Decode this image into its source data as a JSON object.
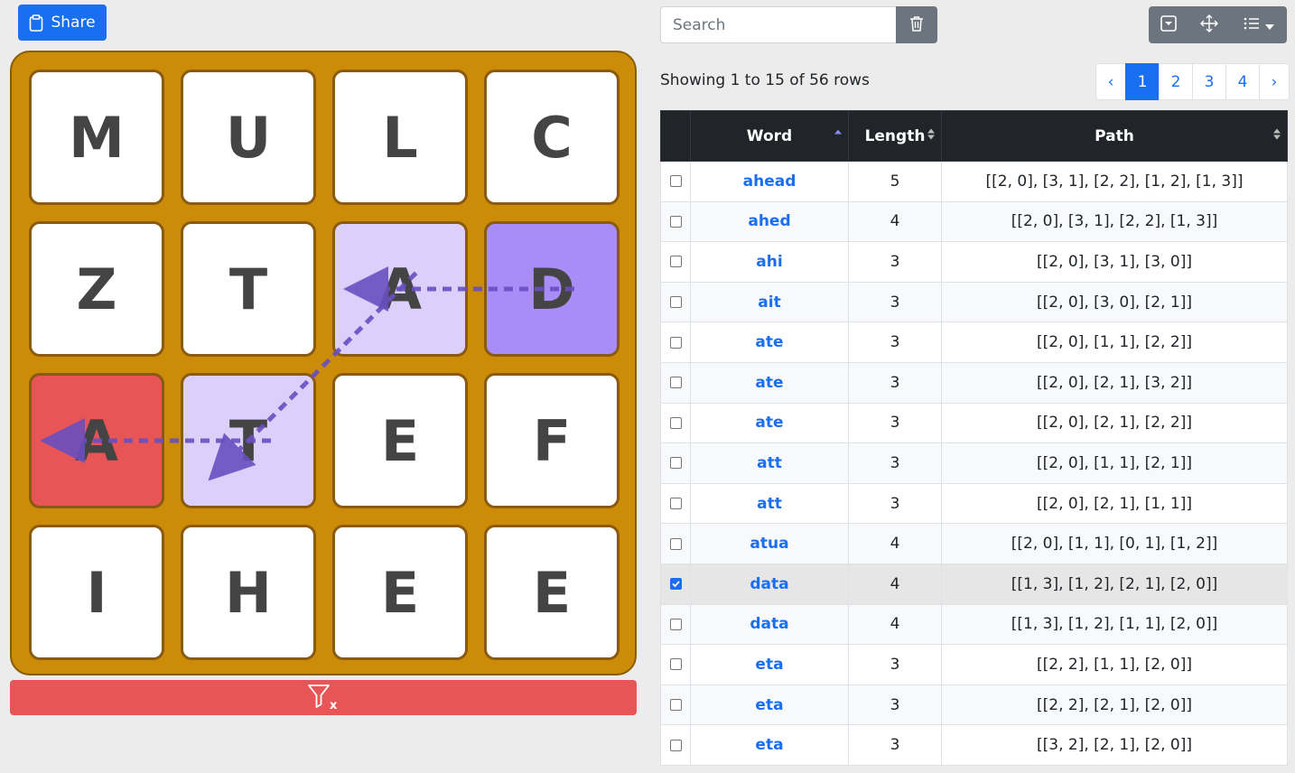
{
  "share": {
    "label": "Share"
  },
  "board": {
    "tiles": [
      [
        "M",
        "U",
        "L",
        "C"
      ],
      [
        "Z",
        "T",
        "A",
        "D"
      ],
      [
        "A",
        "T",
        "E",
        "F"
      ],
      [
        "I",
        "H",
        "E",
        "E"
      ]
    ],
    "selected_path": [
      [
        1,
        3
      ],
      [
        1,
        2
      ],
      [
        2,
        1
      ],
      [
        2,
        0
      ]
    ],
    "colors": {
      "board": "#cc8c07",
      "path": "#dcd0fb",
      "start": "#a88cf8",
      "end": "#e85557",
      "arrow": "#6a4fc0"
    }
  },
  "search": {
    "placeholder": "Search",
    "value": ""
  },
  "summary": {
    "text": "Showing 1 to 15 of 56 rows"
  },
  "pagination": {
    "prev": "‹",
    "pages": [
      "1",
      "2",
      "3",
      "4"
    ],
    "active": "1",
    "next": "›"
  },
  "table": {
    "headers": {
      "word": "Word",
      "length": "Length",
      "path": "Path"
    },
    "rows": [
      {
        "checked": false,
        "word": "ahead",
        "length": "5",
        "path": "[[2, 0], [3, 1], [2, 2], [1, 2], [1, 3]]"
      },
      {
        "checked": false,
        "word": "ahed",
        "length": "4",
        "path": "[[2, 0], [3, 1], [2, 2], [1, 3]]"
      },
      {
        "checked": false,
        "word": "ahi",
        "length": "3",
        "path": "[[2, 0], [3, 1], [3, 0]]"
      },
      {
        "checked": false,
        "word": "ait",
        "length": "3",
        "path": "[[2, 0], [3, 0], [2, 1]]"
      },
      {
        "checked": false,
        "word": "ate",
        "length": "3",
        "path": "[[2, 0], [1, 1], [2, 2]]"
      },
      {
        "checked": false,
        "word": "ate",
        "length": "3",
        "path": "[[2, 0], [2, 1], [3, 2]]"
      },
      {
        "checked": false,
        "word": "ate",
        "length": "3",
        "path": "[[2, 0], [2, 1], [2, 2]]"
      },
      {
        "checked": false,
        "word": "att",
        "length": "3",
        "path": "[[2, 0], [1, 1], [2, 1]]"
      },
      {
        "checked": false,
        "word": "att",
        "length": "3",
        "path": "[[2, 0], [2, 1], [1, 1]]"
      },
      {
        "checked": false,
        "word": "atua",
        "length": "4",
        "path": "[[2, 0], [1, 1], [0, 1], [1, 2]]"
      },
      {
        "checked": true,
        "word": "data",
        "length": "4",
        "path": "[[1, 3], [1, 2], [2, 1], [2, 0]]"
      },
      {
        "checked": false,
        "word": "data",
        "length": "4",
        "path": "[[1, 3], [1, 2], [1, 1], [2, 0]]"
      },
      {
        "checked": false,
        "word": "eta",
        "length": "3",
        "path": "[[2, 2], [1, 1], [2, 0]]"
      },
      {
        "checked": false,
        "word": "eta",
        "length": "3",
        "path": "[[2, 2], [2, 1], [2, 0]]"
      },
      {
        "checked": false,
        "word": "eta",
        "length": "3",
        "path": "[[3, 2], [2, 1], [2, 0]]"
      }
    ]
  }
}
